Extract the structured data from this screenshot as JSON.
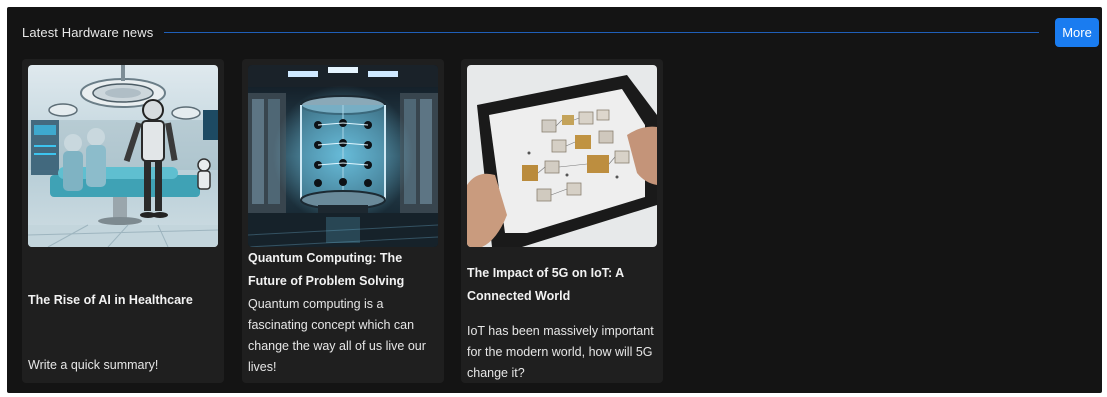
{
  "header": {
    "title": "Latest Hardware news",
    "more_label": "More"
  },
  "cards": [
    {
      "title": "The Rise of AI in Healthcare",
      "summary": "Write a quick summary!",
      "image_icon": "robot-surgery-image"
    },
    {
      "title": "Quantum Computing: The Future of Problem Solving",
      "summary": "Quantum computing is a fascinating concept which can change the way all of us live our lives!",
      "image_icon": "quantum-computer-image"
    },
    {
      "title": "The Impact of 5G on IoT: A Connected World",
      "summary": "IoT has been massively important for the modern world, how will 5G change it?",
      "image_icon": "tablet-image"
    }
  ],
  "colors": {
    "panel_bg": "#141414",
    "card_bg": "#1f1f1f",
    "accent": "#1a7cf0",
    "divider": "#1f5fb8"
  }
}
